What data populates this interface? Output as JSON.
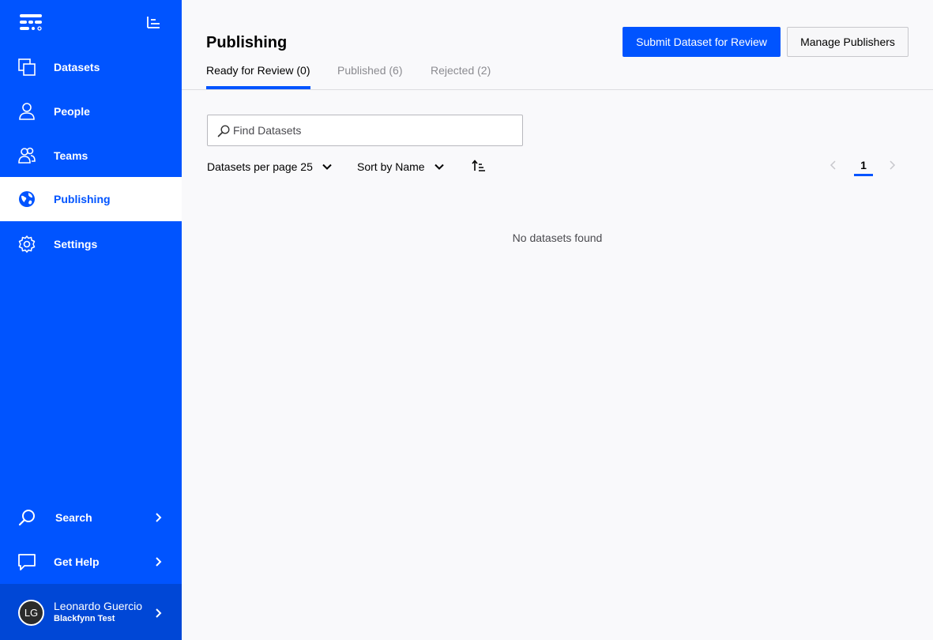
{
  "sidebar": {
    "items": [
      {
        "label": "Datasets",
        "icon": "datasets-icon"
      },
      {
        "label": "People",
        "icon": "person-icon"
      },
      {
        "label": "Teams",
        "icon": "team-icon"
      },
      {
        "label": "Publishing",
        "icon": "globe-icon",
        "active": true
      },
      {
        "label": "Settings",
        "icon": "gear-icon"
      }
    ],
    "bottom_items": [
      {
        "label": "Search",
        "icon": "search-icon"
      },
      {
        "label": "Get Help",
        "icon": "chat-icon"
      }
    ],
    "user": {
      "initials": "LG",
      "name": "Leonardo Guercio",
      "org": "Blackfynn Test"
    }
  },
  "header": {
    "title": "Publishing",
    "submit_button": "Submit Dataset for Review",
    "manage_button": "Manage Publishers"
  },
  "tabs": [
    {
      "label": "Ready for Review (0)",
      "active": true
    },
    {
      "label": "Published (6)"
    },
    {
      "label": "Rejected (2)"
    }
  ],
  "search": {
    "placeholder": "Find Datasets",
    "value": ""
  },
  "controls": {
    "per_page": "Datasets per page 25",
    "sort": "Sort by Name",
    "sort_direction": "ascending"
  },
  "pagination": {
    "current_page": "1"
  },
  "empty_state": "No datasets found",
  "colors": {
    "accent": "#0054ff",
    "sidebar": "#0054ff",
    "user_panel": "#0047d6",
    "background": "#f9f9fb"
  }
}
